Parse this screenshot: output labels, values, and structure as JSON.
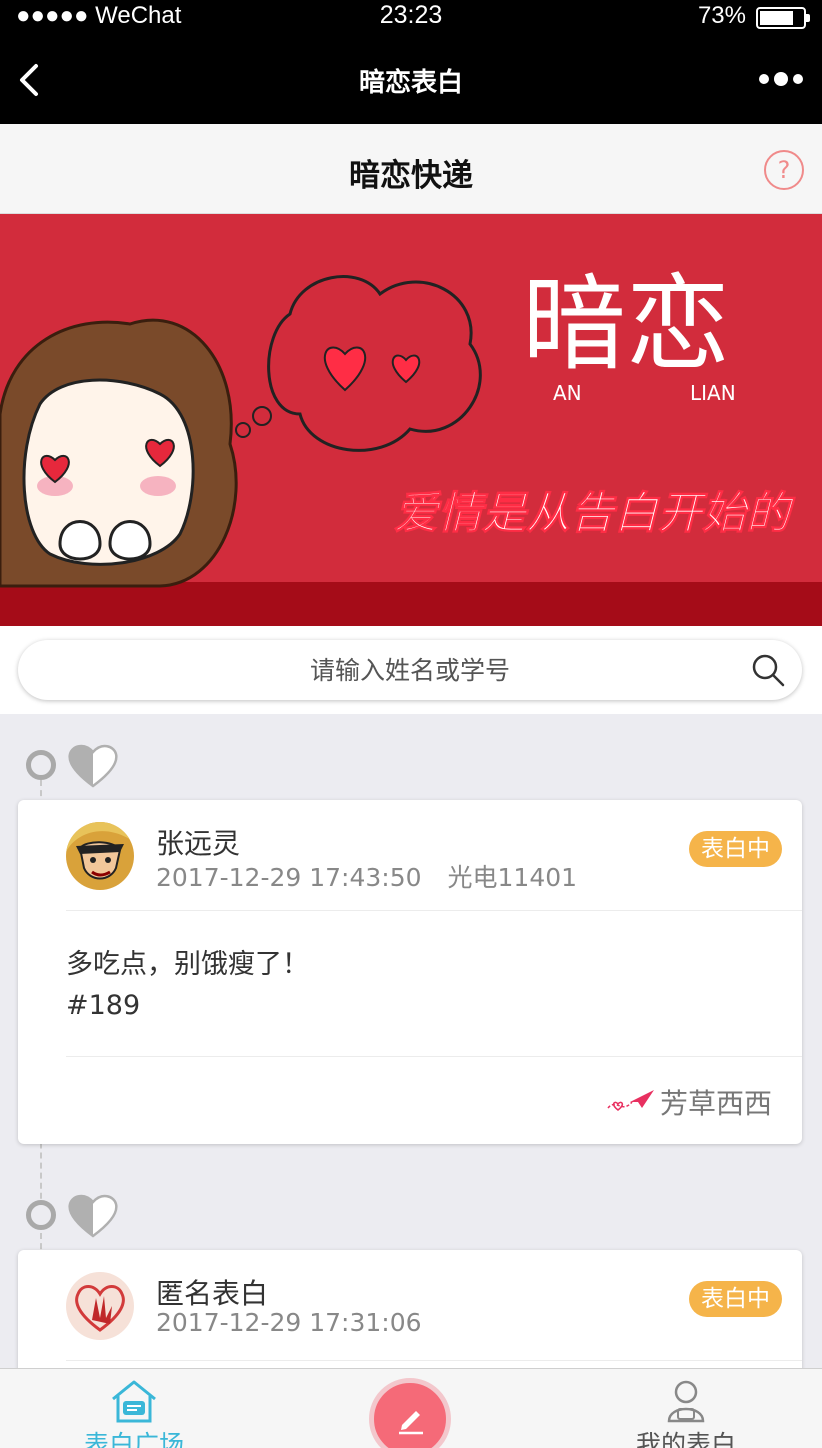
{
  "status_bar": {
    "carrier": "●●●●● WeChat",
    "time": "23:23",
    "battery": "73%",
    "battery_level": 0.73
  },
  "nav": {
    "title": "暗恋表白"
  },
  "header": {
    "title": "暗恋快递",
    "help_icon": "?"
  },
  "banner": {
    "logo_text": "暗恋",
    "logo_left": "AN",
    "logo_right": "LIAN",
    "slogan": "爱情是从告白开始的"
  },
  "search": {
    "placeholder": "请输入姓名或学号"
  },
  "posts": [
    {
      "name": "张远灵",
      "time": "2017-12-29 17:43:50",
      "class": "光电11401",
      "status": "表白中",
      "message": "多吃点，别饿瘦了！",
      "number": "#189",
      "from": "芳草西西"
    },
    {
      "name": "匿名表白",
      "time": "2017-12-29 17:31:06",
      "class": "",
      "status": "表白中"
    }
  ],
  "tabs": [
    {
      "label": "表白广场",
      "icon": "home-message-icon",
      "active": true
    },
    {
      "label": "我的表白",
      "icon": "person-icon",
      "active": false
    }
  ],
  "compose": {
    "icon": "pencil-icon"
  },
  "colors": {
    "badge": "#f5b44a",
    "active_tab": "#3ab7d8",
    "compose": "#f56a78",
    "banner": "#d22c3c"
  }
}
